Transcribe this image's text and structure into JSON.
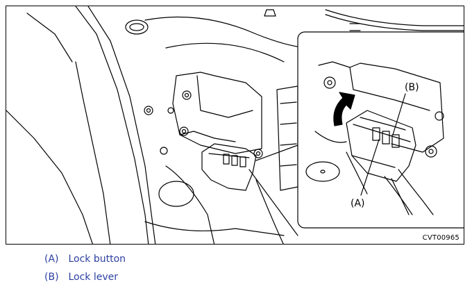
{
  "figure": {
    "code": "CVT00965",
    "callouts": {
      "a": "(A)",
      "b": "(B)"
    }
  },
  "legend": [
    {
      "key": "(A)",
      "text": "Lock button"
    },
    {
      "key": "(B)",
      "text": "Lock lever"
    }
  ],
  "colors": {
    "line": "#000000",
    "legend_text": "#2b3fa0"
  }
}
